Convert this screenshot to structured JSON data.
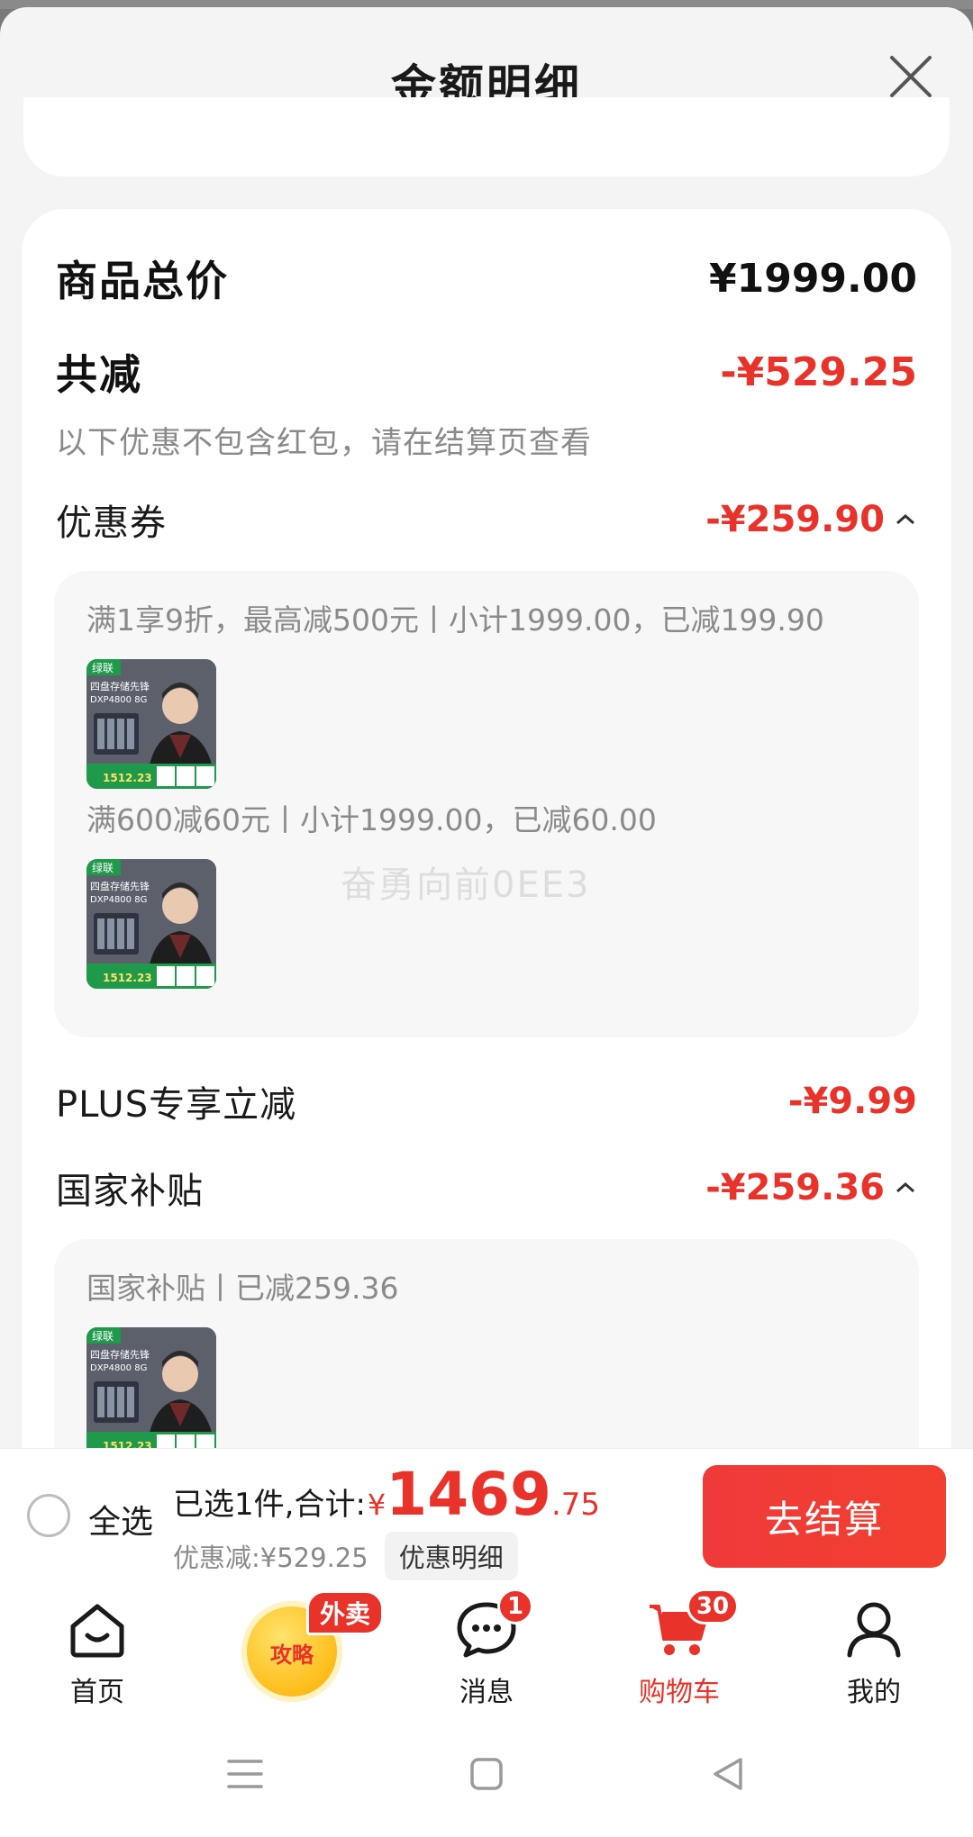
{
  "sheet": {
    "title": "金额明细"
  },
  "summary": {
    "total_label": "商品总价",
    "total_value": "¥1999.00",
    "reduce_label": "共减",
    "reduce_value": "-¥529.25",
    "note": "以下优惠不包含红包，请在结算页查看"
  },
  "coupon": {
    "label": "优惠券",
    "value": "-¥259.90",
    "items": [
      {
        "text": "满1享9折，最高减500元丨小计1999.00，已减199.90"
      },
      {
        "text": "满600减60元丨小计1999.00，已减60.00"
      }
    ]
  },
  "watermark": "奋勇向前0EE3",
  "plus": {
    "label": "PLUS专享立减",
    "value": "-¥9.99"
  },
  "subsidy": {
    "label": "国家补贴",
    "value": "-¥259.36",
    "items": [
      {
        "text": "国家补贴丨已减259.36"
      }
    ]
  },
  "thumb": {
    "brand": "绿联",
    "line1": "四盘存储先锋",
    "line2": "DXP4800 8G",
    "price": "1512.23"
  },
  "checkout": {
    "select_all": "全选",
    "selected_prefix": "已选1件,合计:",
    "currency": "¥",
    "amount_int": "1469",
    "amount_dec": ".75",
    "discount_text": "优惠减:¥529.25",
    "discount_detail_btn": "优惠明细",
    "pay_btn": "去结算"
  },
  "tabs": [
    {
      "label": "首页",
      "icon": "home-icon"
    },
    {
      "label": "",
      "icon": "promo-icon"
    },
    {
      "label": "消息",
      "icon": "message-icon",
      "badge": "1"
    },
    {
      "label": "购物车",
      "icon": "cart-icon",
      "badge": "30"
    },
    {
      "label": "我的",
      "icon": "user-icon"
    }
  ],
  "promo": {
    "tag": "外卖",
    "text": "攻略"
  },
  "colors": {
    "accent": "#e8322a",
    "text": "#1a1a1a",
    "muted": "#8a8a8a"
  }
}
